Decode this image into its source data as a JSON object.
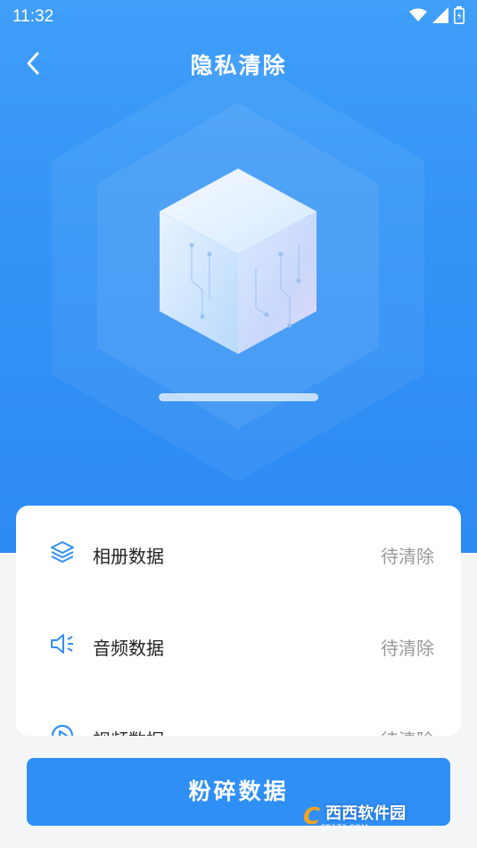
{
  "status_bar": {
    "time": "11:32"
  },
  "header": {
    "title": "隐私清除",
    "back_icon": "chevron-left-icon"
  },
  "scan": {
    "progress_fraction": 0.0
  },
  "items": [
    {
      "label": "相册数据",
      "status": "待清除",
      "icon": "layers-icon"
    },
    {
      "label": "音频数据",
      "status": "待清除",
      "icon": "speaker-icon"
    },
    {
      "label": "视频数据",
      "status": "待清除",
      "icon": "play-circle-icon"
    }
  ],
  "action_button": {
    "label": "粉碎数据"
  },
  "watermark": {
    "logo": "C",
    "text": "西西软件园",
    "sub": "CR173.COM"
  },
  "colors": {
    "primary": "#2f8ff5",
    "hero_top": "#3f9ef8",
    "background": "#f4f5f7",
    "status_text": "#9a9a9a"
  }
}
